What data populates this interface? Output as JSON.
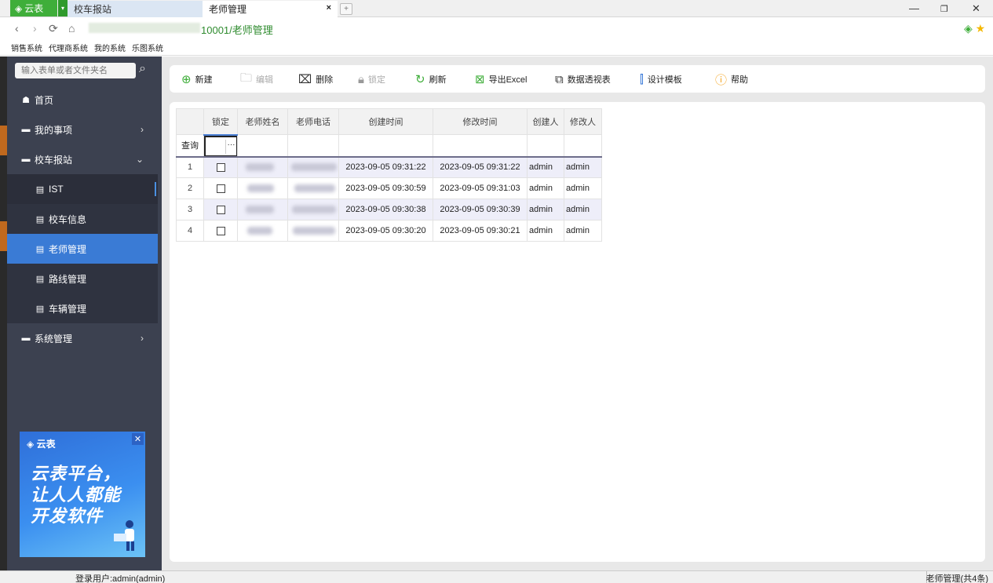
{
  "titlebar": {
    "app_name": "云表",
    "tabs": [
      {
        "label": "校车报站"
      },
      {
        "label": "老师管理"
      }
    ],
    "close_glyph": "×",
    "new_tab_glyph": "+",
    "win_min": "—",
    "win_max": "❐",
    "win_close": "✕"
  },
  "addressbar": {
    "url_suffix": "10001/老师管理"
  },
  "bookmarks": [
    "销售系统",
    "代理商系统",
    "我的系统",
    "乐图系统"
  ],
  "sidebar": {
    "search_placeholder": "输入表单或者文件夹名",
    "items": [
      {
        "label": "首页"
      },
      {
        "label": "我的事项"
      },
      {
        "label": "校车报站"
      },
      {
        "label": "IST"
      },
      {
        "label": "校车信息"
      },
      {
        "label": "老师管理"
      },
      {
        "label": "路线管理"
      },
      {
        "label": "车辆管理"
      },
      {
        "label": "系统管理"
      }
    ],
    "banner": {
      "logo_text": "云表",
      "line1": "云表平台，",
      "line2": "让人人都能",
      "line3": "开发软件"
    }
  },
  "toolbar": {
    "new": "新建",
    "edit": "编辑",
    "delete": "删除",
    "lock": "锁定",
    "refresh": "刷新",
    "export": "导出Excel",
    "pivot": "数据透视表",
    "design": "设计模板",
    "help": "帮助"
  },
  "grid": {
    "headers": [
      "锁定",
      "老师姓名",
      "老师电话",
      "创建时间",
      "修改时间",
      "创建人",
      "修改人"
    ],
    "filter_label": "查询",
    "rows": [
      {
        "no": "1",
        "created": "2023-09-05 09:31:22",
        "modified": "2023-09-05 09:31:22",
        "creator": "admin",
        "modifier": "admin"
      },
      {
        "no": "2",
        "created": "2023-09-05 09:30:59",
        "modified": "2023-09-05 09:31:03",
        "creator": "admin",
        "modifier": "admin"
      },
      {
        "no": "3",
        "created": "2023-09-05 09:30:38",
        "modified": "2023-09-05 09:30:39",
        "creator": "admin",
        "modifier": "admin"
      },
      {
        "no": "4",
        "created": "2023-09-05 09:30:20",
        "modified": "2023-09-05 09:30:21",
        "creator": "admin",
        "modifier": "admin"
      }
    ]
  },
  "statusbar": {
    "user": "登录用户:admin(admin)",
    "summary": "老师管理(共4条)"
  }
}
